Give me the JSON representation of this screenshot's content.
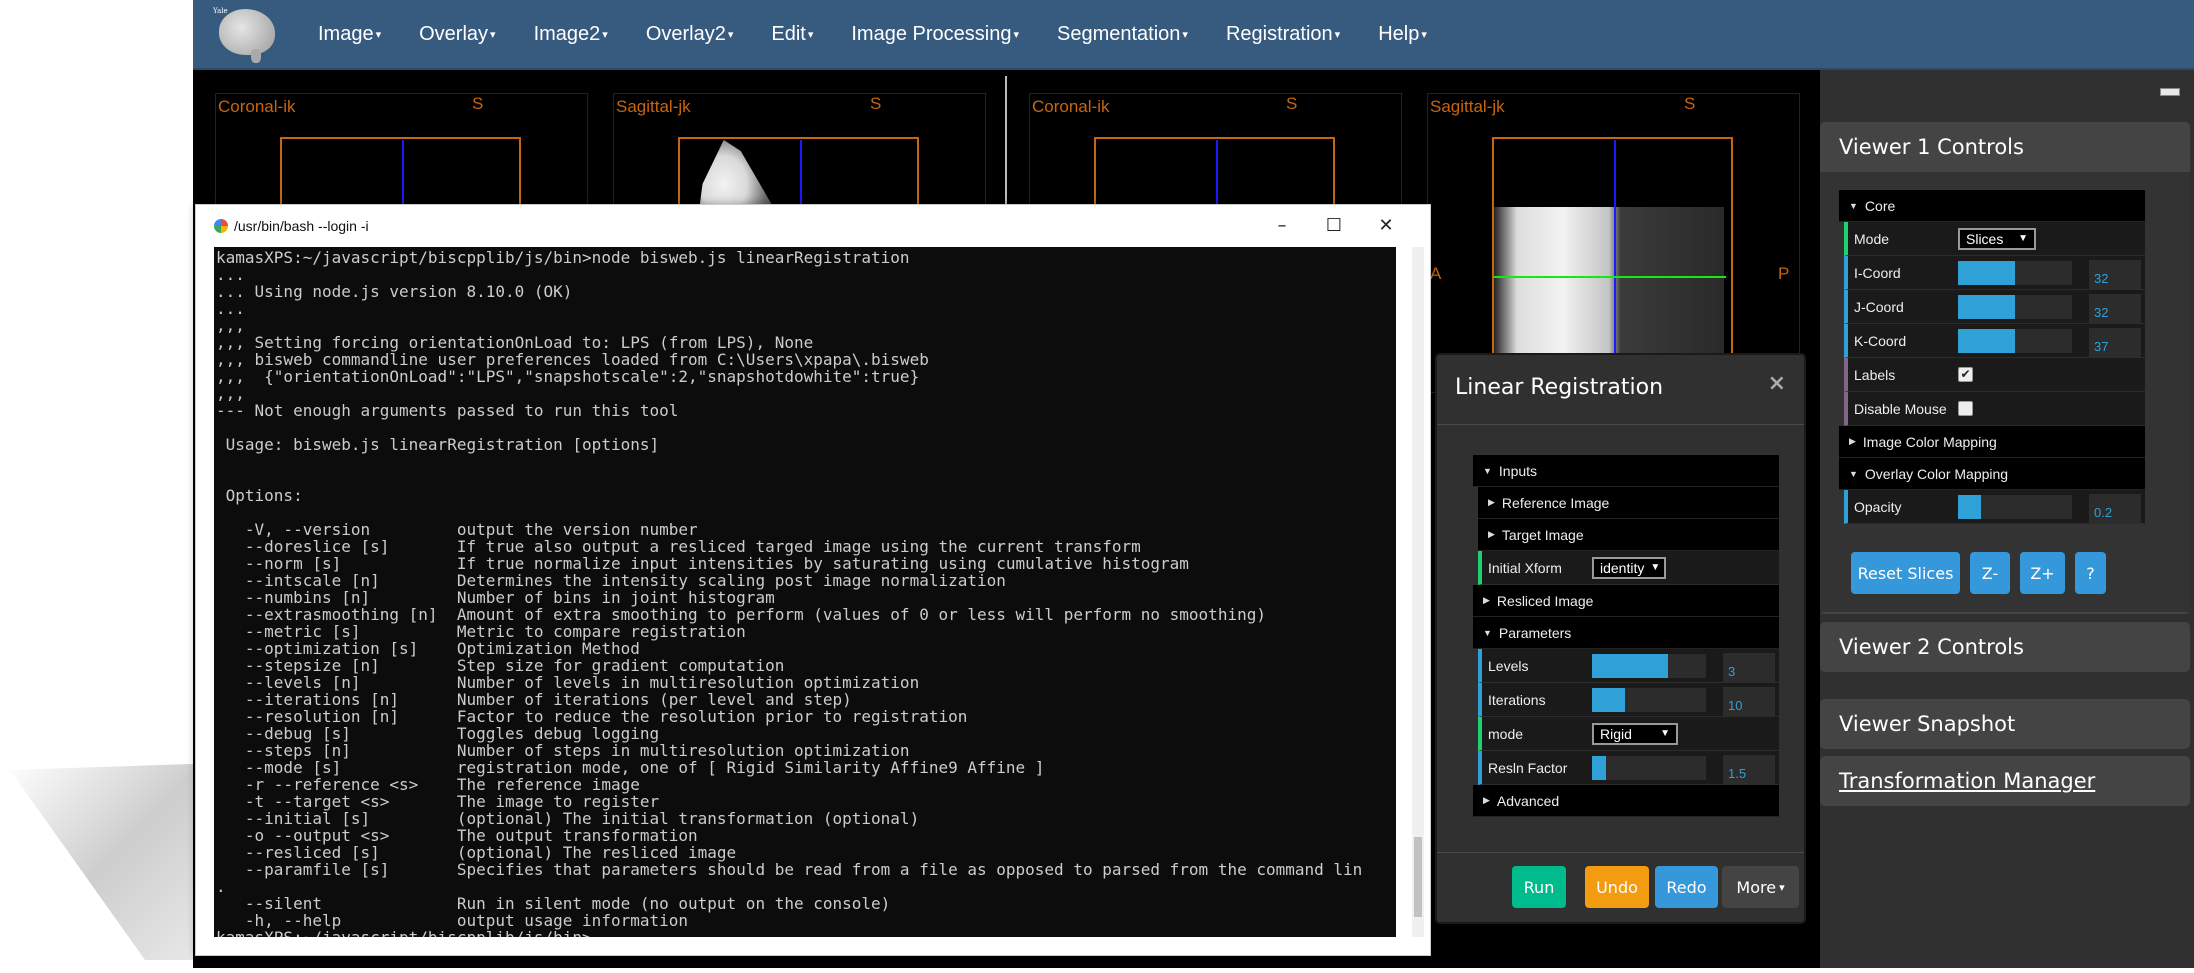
{
  "navbar": {
    "logo_text": "Yale",
    "menus": [
      {
        "label": "Image"
      },
      {
        "label": "Overlay"
      },
      {
        "label": "Image2"
      },
      {
        "label": "Overlay2"
      },
      {
        "label": "Edit"
      },
      {
        "label": "Image Processing"
      },
      {
        "label": "Segmentation"
      },
      {
        "label": "Registration"
      },
      {
        "label": "Help"
      }
    ],
    "caret": "▾"
  },
  "viewers": [
    {
      "view_label": "Coronal-ik",
      "orient_top": "S"
    },
    {
      "view_label": "Sagittal-jk",
      "orient_top": "S"
    },
    {
      "view_label": "Coronal-ik",
      "orient_top": "S"
    },
    {
      "view_label": "Sagittal-jk",
      "orient_top": "S",
      "orient_left": "A",
      "orient_right": "P"
    }
  ],
  "terminal": {
    "title": "/usr/bin/bash --login -i",
    "controls": {
      "minimize": "–",
      "maximize": "☐",
      "close": "✕"
    },
    "lines": [
      "kamasXPS:~/javascript/biscpplib/js/bin>node bisweb.js linearRegistration",
      "...",
      "... Using node.js version 8.10.0 (OK)",
      "...",
      ",,,",
      ",,, Setting forcing orientationOnLoad to: LPS (from LPS), None",
      ",,, bisweb commandline user preferences loaded from C:\\Users\\xpapa\\.bisweb",
      ",,,  {\"orientationOnLoad\":\"LPS\",\"snapshotscale\":2,\"snapshotdowhite\":true}",
      ",,,",
      "--- Not enough arguments passed to run this tool",
      "",
      " Usage: bisweb.js linearRegistration [options]",
      "",
      "",
      " Options:",
      "",
      "   -V, --version         output the version number",
      "   --doreslice [s]       If true also output a resliced targed image using the current transform",
      "   --norm [s]            If true normalize input intensities by saturating using cumulative histogram",
      "   --intscale [n]        Determines the intensity scaling post image normalization",
      "   --numbins [n]         Number of bins in joint histogram",
      "   --extrasmoothing [n]  Amount of extra smoothing to perform (values of 0 or less will perform no smoothing)",
      "   --metric [s]          Metric to compare registration",
      "   --optimization [s]    Optimization Method",
      "   --stepsize [n]        Step size for gradient computation",
      "   --levels [n]          Number of levels in multiresolution optimization",
      "   --iterations [n]      Number of iterations (per level and step)",
      "   --resolution [n]      Factor to reduce the resolution prior to registration",
      "   --debug [s]           Toggles debug logging",
      "   --steps [n]           Number of steps in multiresolution optimization",
      "   --mode [s]            registration mode, one of [ Rigid Similarity Affine9 Affine ]",
      "   -r --reference <s>    The reference image",
      "   -t --target <s>       The image to register",
      "   --initial [s]         (optional) The initial transformation (optional)",
      "   -o --output <s>       The output transformation",
      "   --resliced [s]        (optional) The resliced image",
      "   --paramfile [s]       Specifies that parameters should be read from a file as opposed to parsed from the command lin",
      ".",
      "   --silent              Run in silent mode (no output on the console)",
      "   -h, --help            output usage information",
      "kamasXPS:~/javascript/biscpplib/js/bin>"
    ]
  },
  "linear_registration": {
    "title": "Linear Registration",
    "close": "×",
    "folders": {
      "inputs": "Inputs",
      "reference_image": "Reference Image",
      "target_image": "Target Image",
      "resliced_image": "Resliced Image",
      "parameters": "Parameters",
      "advanced": "Advanced"
    },
    "initial_xform": {
      "label": "Initial Xform",
      "value": "identity"
    },
    "levels": {
      "label": "Levels",
      "value": "3",
      "fill_fraction": 0.67
    },
    "iterations": {
      "label": "Iterations",
      "value": "10",
      "fill_fraction": 0.29
    },
    "mode": {
      "label": "mode",
      "value": "Rigid"
    },
    "resln_factor": {
      "label": "Resln Factor",
      "value": "1.5",
      "fill_fraction": 0.12
    },
    "buttons": {
      "run": "Run",
      "undo": "Undo",
      "redo": "Redo",
      "more": "More"
    }
  },
  "right_panel": {
    "viewer1": {
      "title": "Viewer 1 Controls",
      "core_folder": "Core",
      "mode": {
        "label": "Mode",
        "value": "Slices"
      },
      "i_coord": {
        "label": "I-Coord",
        "value": "32",
        "fill_fraction": 0.5
      },
      "j_coord": {
        "label": "J-Coord",
        "value": "32",
        "fill_fraction": 0.5
      },
      "k_coord": {
        "label": "K-Coord",
        "value": "37",
        "fill_fraction": 0.5
      },
      "labels": {
        "label": "Labels",
        "checked": true,
        "mark": "✔"
      },
      "disable_mouse": {
        "label": "Disable Mouse",
        "checked": false
      },
      "image_color_mapping": "Image Color Mapping",
      "overlay_color_mapping": "Overlay Color Mapping",
      "opacity": {
        "label": "Opacity",
        "value": "0.2",
        "fill_fraction": 0.2
      },
      "buttons": {
        "reset_slices": "Reset Slices",
        "z_minus": "Z-",
        "z_plus": "Z+",
        "help": "?"
      }
    },
    "viewer2_title": "Viewer 2 Controls",
    "snapshot_title": "Viewer Snapshot",
    "transform_manager_title": "Transformation Manager"
  },
  "colors": {
    "navbar": "#375a7f",
    "orientation_orange": "#c8650d",
    "accent_blue": "#2fa1d6",
    "run_green": "#00bc8c",
    "undo_orange": "#f39c12",
    "redo_blue": "#3498db",
    "more_gray": "#444444"
  }
}
